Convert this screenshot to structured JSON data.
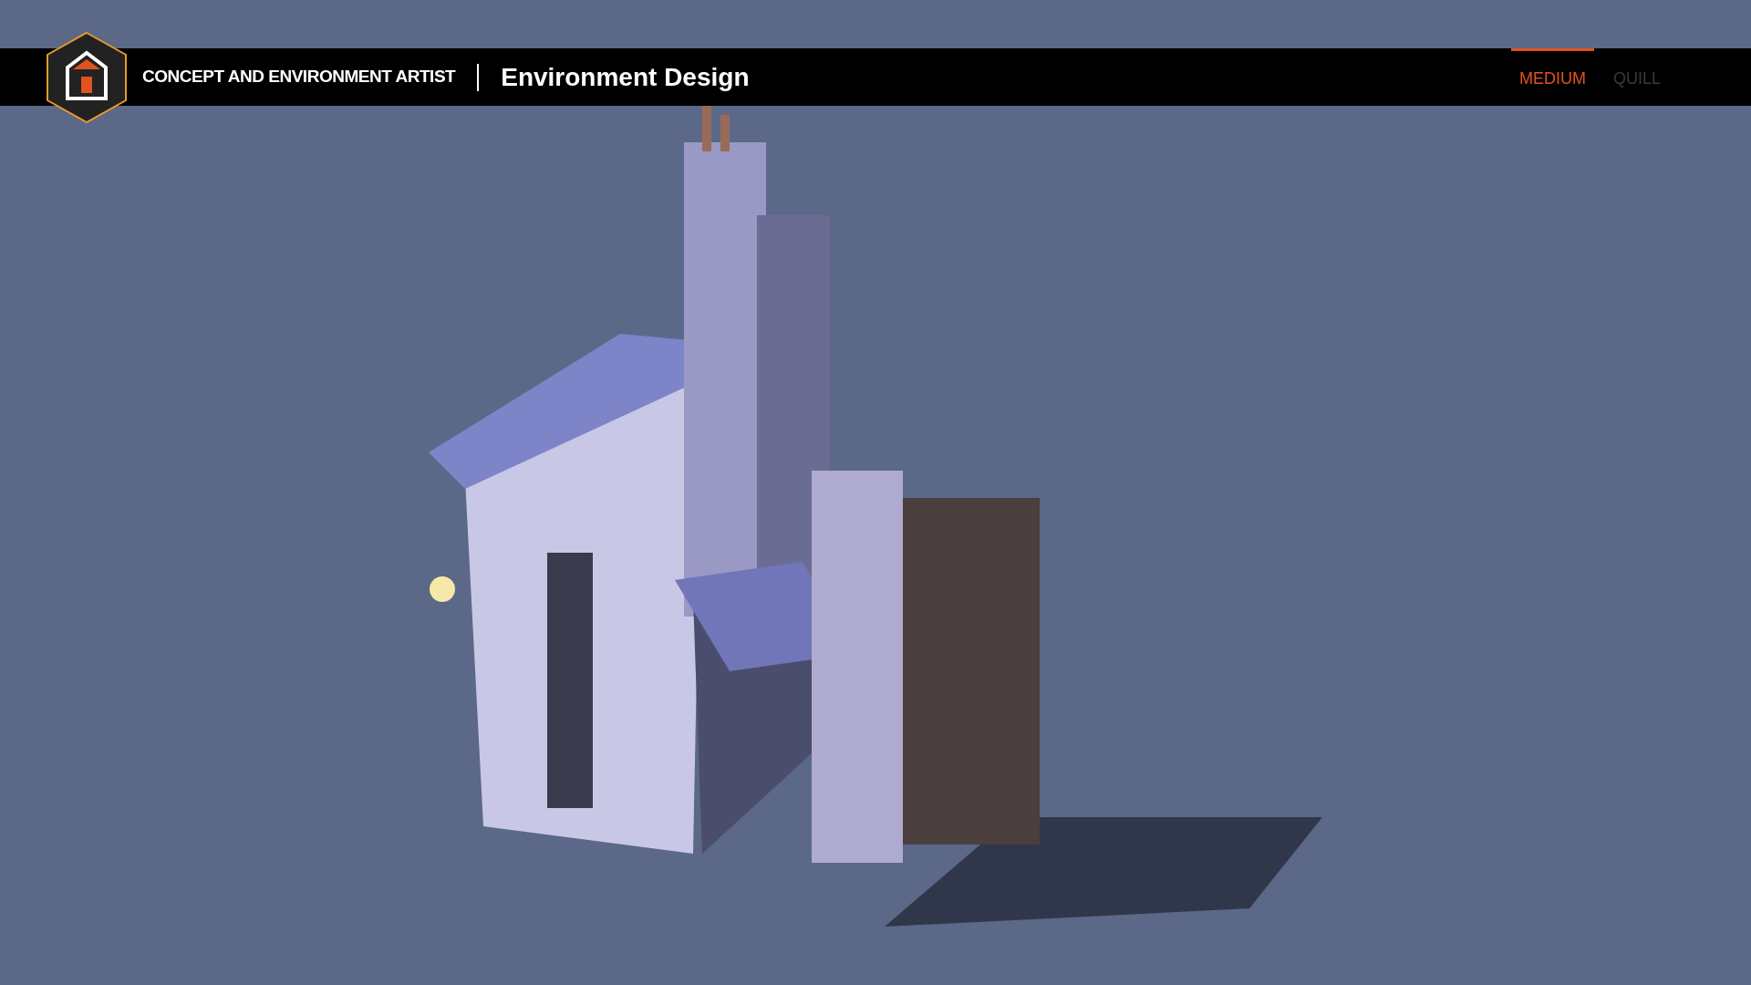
{
  "header": {
    "subtitle": "CONCEPT AND ENVIRONMENT ARTIST",
    "title": "Environment Design"
  },
  "tabs": [
    {
      "label": "MEDIUM",
      "selected": true
    },
    {
      "label": "QUILL",
      "selected": false
    }
  ]
}
